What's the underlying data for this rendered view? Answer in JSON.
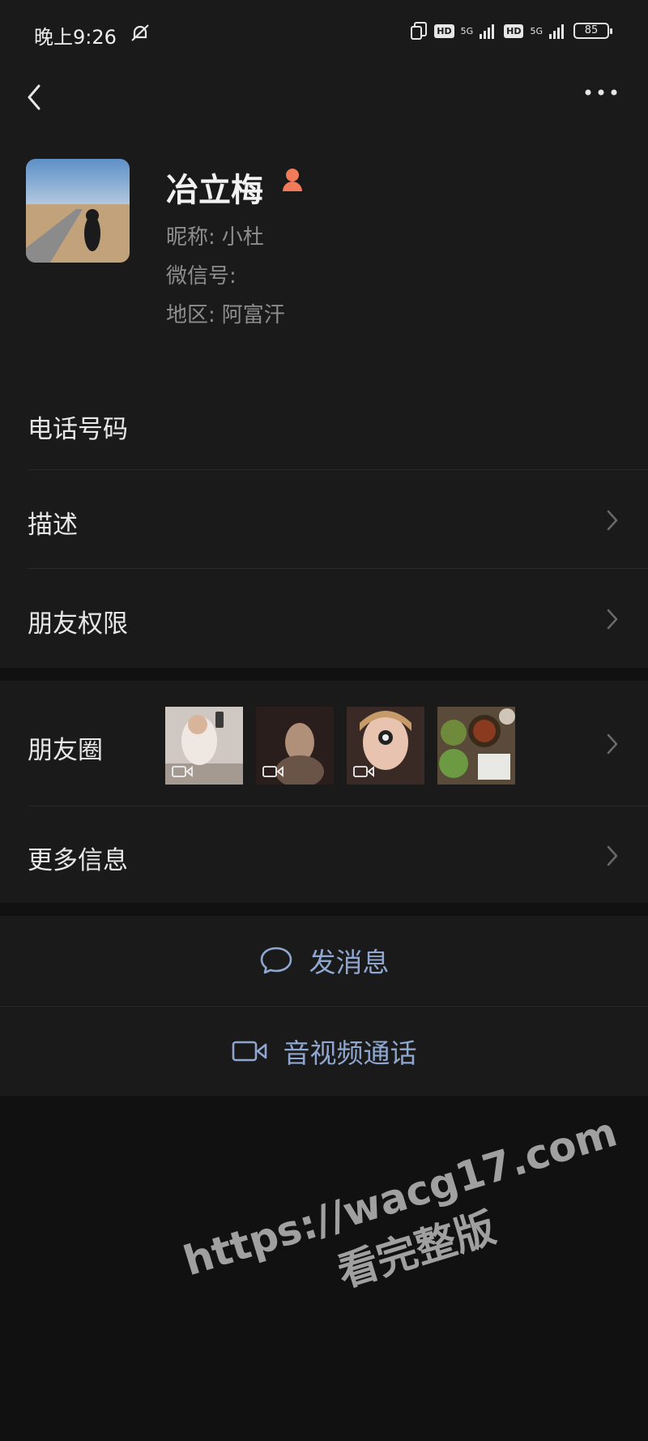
{
  "status_bar": {
    "time": "晚上9:26",
    "network_1": "5G",
    "network_2": "5G",
    "hd_1": "HD",
    "hd_2": "HD",
    "battery": "85",
    "icons": [
      "mute-icon",
      "sim-icon",
      "signal-icon",
      "battery-icon"
    ]
  },
  "header": {
    "back_icon": "chevron-left-icon",
    "more_icon": "more-dots-icon"
  },
  "profile": {
    "name": "冶立梅",
    "nickname_label": "昵称:",
    "nickname": "小杜",
    "wechat_id_label": "微信号:",
    "region_label": "地区:",
    "region": "阿富汗"
  },
  "rows": {
    "phone": "电话号码",
    "description": "描述",
    "friend_permission": "朋友权限",
    "moments": "朋友圈",
    "more_info": "更多信息"
  },
  "actions": {
    "send_message": "发消息",
    "video_call": "音视频通话"
  },
  "watermark": {
    "url": "https://wacg17.com",
    "tag": "看完整版"
  },
  "colors": {
    "background": "#111111",
    "panel": "#1a1a1a",
    "accent": "#8fa7cf",
    "secondary_text": "#8e8e8e"
  }
}
